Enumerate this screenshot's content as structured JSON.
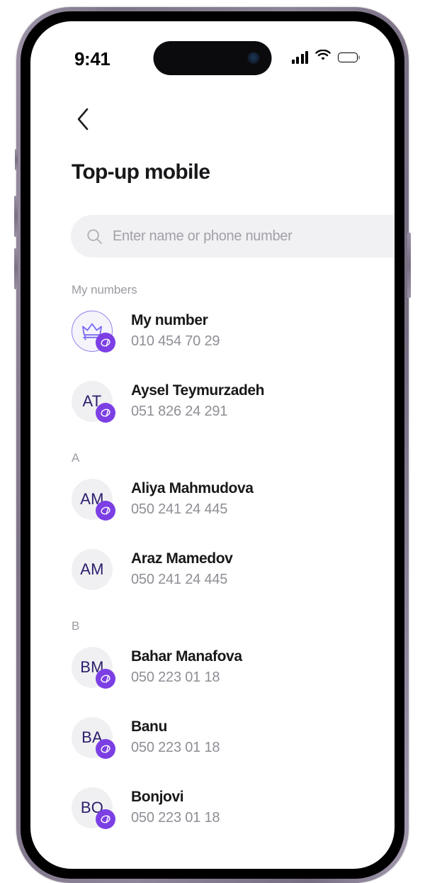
{
  "status_bar": {
    "time": "9:41",
    "signal_icon": "cellular-signal-icon",
    "wifi_icon": "wifi-icon",
    "battery_icon": "battery-full-icon"
  },
  "header": {
    "back_icon": "chevron-left-icon",
    "title": "Top-up mobile"
  },
  "search": {
    "icon": "search-icon",
    "placeholder": "Enter name or phone number",
    "value": ""
  },
  "colors": {
    "accent_purple": "#7b3fe4",
    "avatar_initials": "#2c1d6b",
    "avatar_bg": "#f0f0f2",
    "my_avatar_border": "#8f86ea",
    "title": "#18181b",
    "muted_text": "#8e8e96",
    "section_text": "#9a9aa2",
    "search_bg": "#f1f1f3",
    "frame": "#8e8499"
  },
  "sections": [
    {
      "label": "My numbers",
      "contacts": [
        {
          "name": "My number",
          "phone": "010 454 70 29",
          "initials": "",
          "avatar_icon": "crown-icon",
          "is_mine": true,
          "operator_badge": true
        },
        {
          "name": "Aysel Teymurzadeh",
          "phone": "051 826 24 291",
          "initials": "AT",
          "avatar_icon": "",
          "is_mine": false,
          "operator_badge": true
        }
      ]
    },
    {
      "label": "A",
      "contacts": [
        {
          "name": "Aliya Mahmudova",
          "phone": "050 241 24 445",
          "initials": "AM",
          "avatar_icon": "",
          "is_mine": false,
          "operator_badge": true
        },
        {
          "name": "Araz Mamedov",
          "phone": "050 241 24 445",
          "initials": "AM",
          "avatar_icon": "",
          "is_mine": false,
          "operator_badge": false
        }
      ]
    },
    {
      "label": "B",
      "contacts": [
        {
          "name": "Bahar Manafova",
          "phone": "050 223 01 18",
          "initials": "BM",
          "avatar_icon": "",
          "is_mine": false,
          "operator_badge": true
        },
        {
          "name": "Banu",
          "phone": "050 223 01 18",
          "initials": "BA",
          "avatar_icon": "",
          "is_mine": false,
          "operator_badge": true
        },
        {
          "name": "Bonjovi",
          "phone": "050 223 01 18",
          "initials": "BO",
          "avatar_icon": "",
          "is_mine": false,
          "operator_badge": true
        }
      ]
    }
  ]
}
